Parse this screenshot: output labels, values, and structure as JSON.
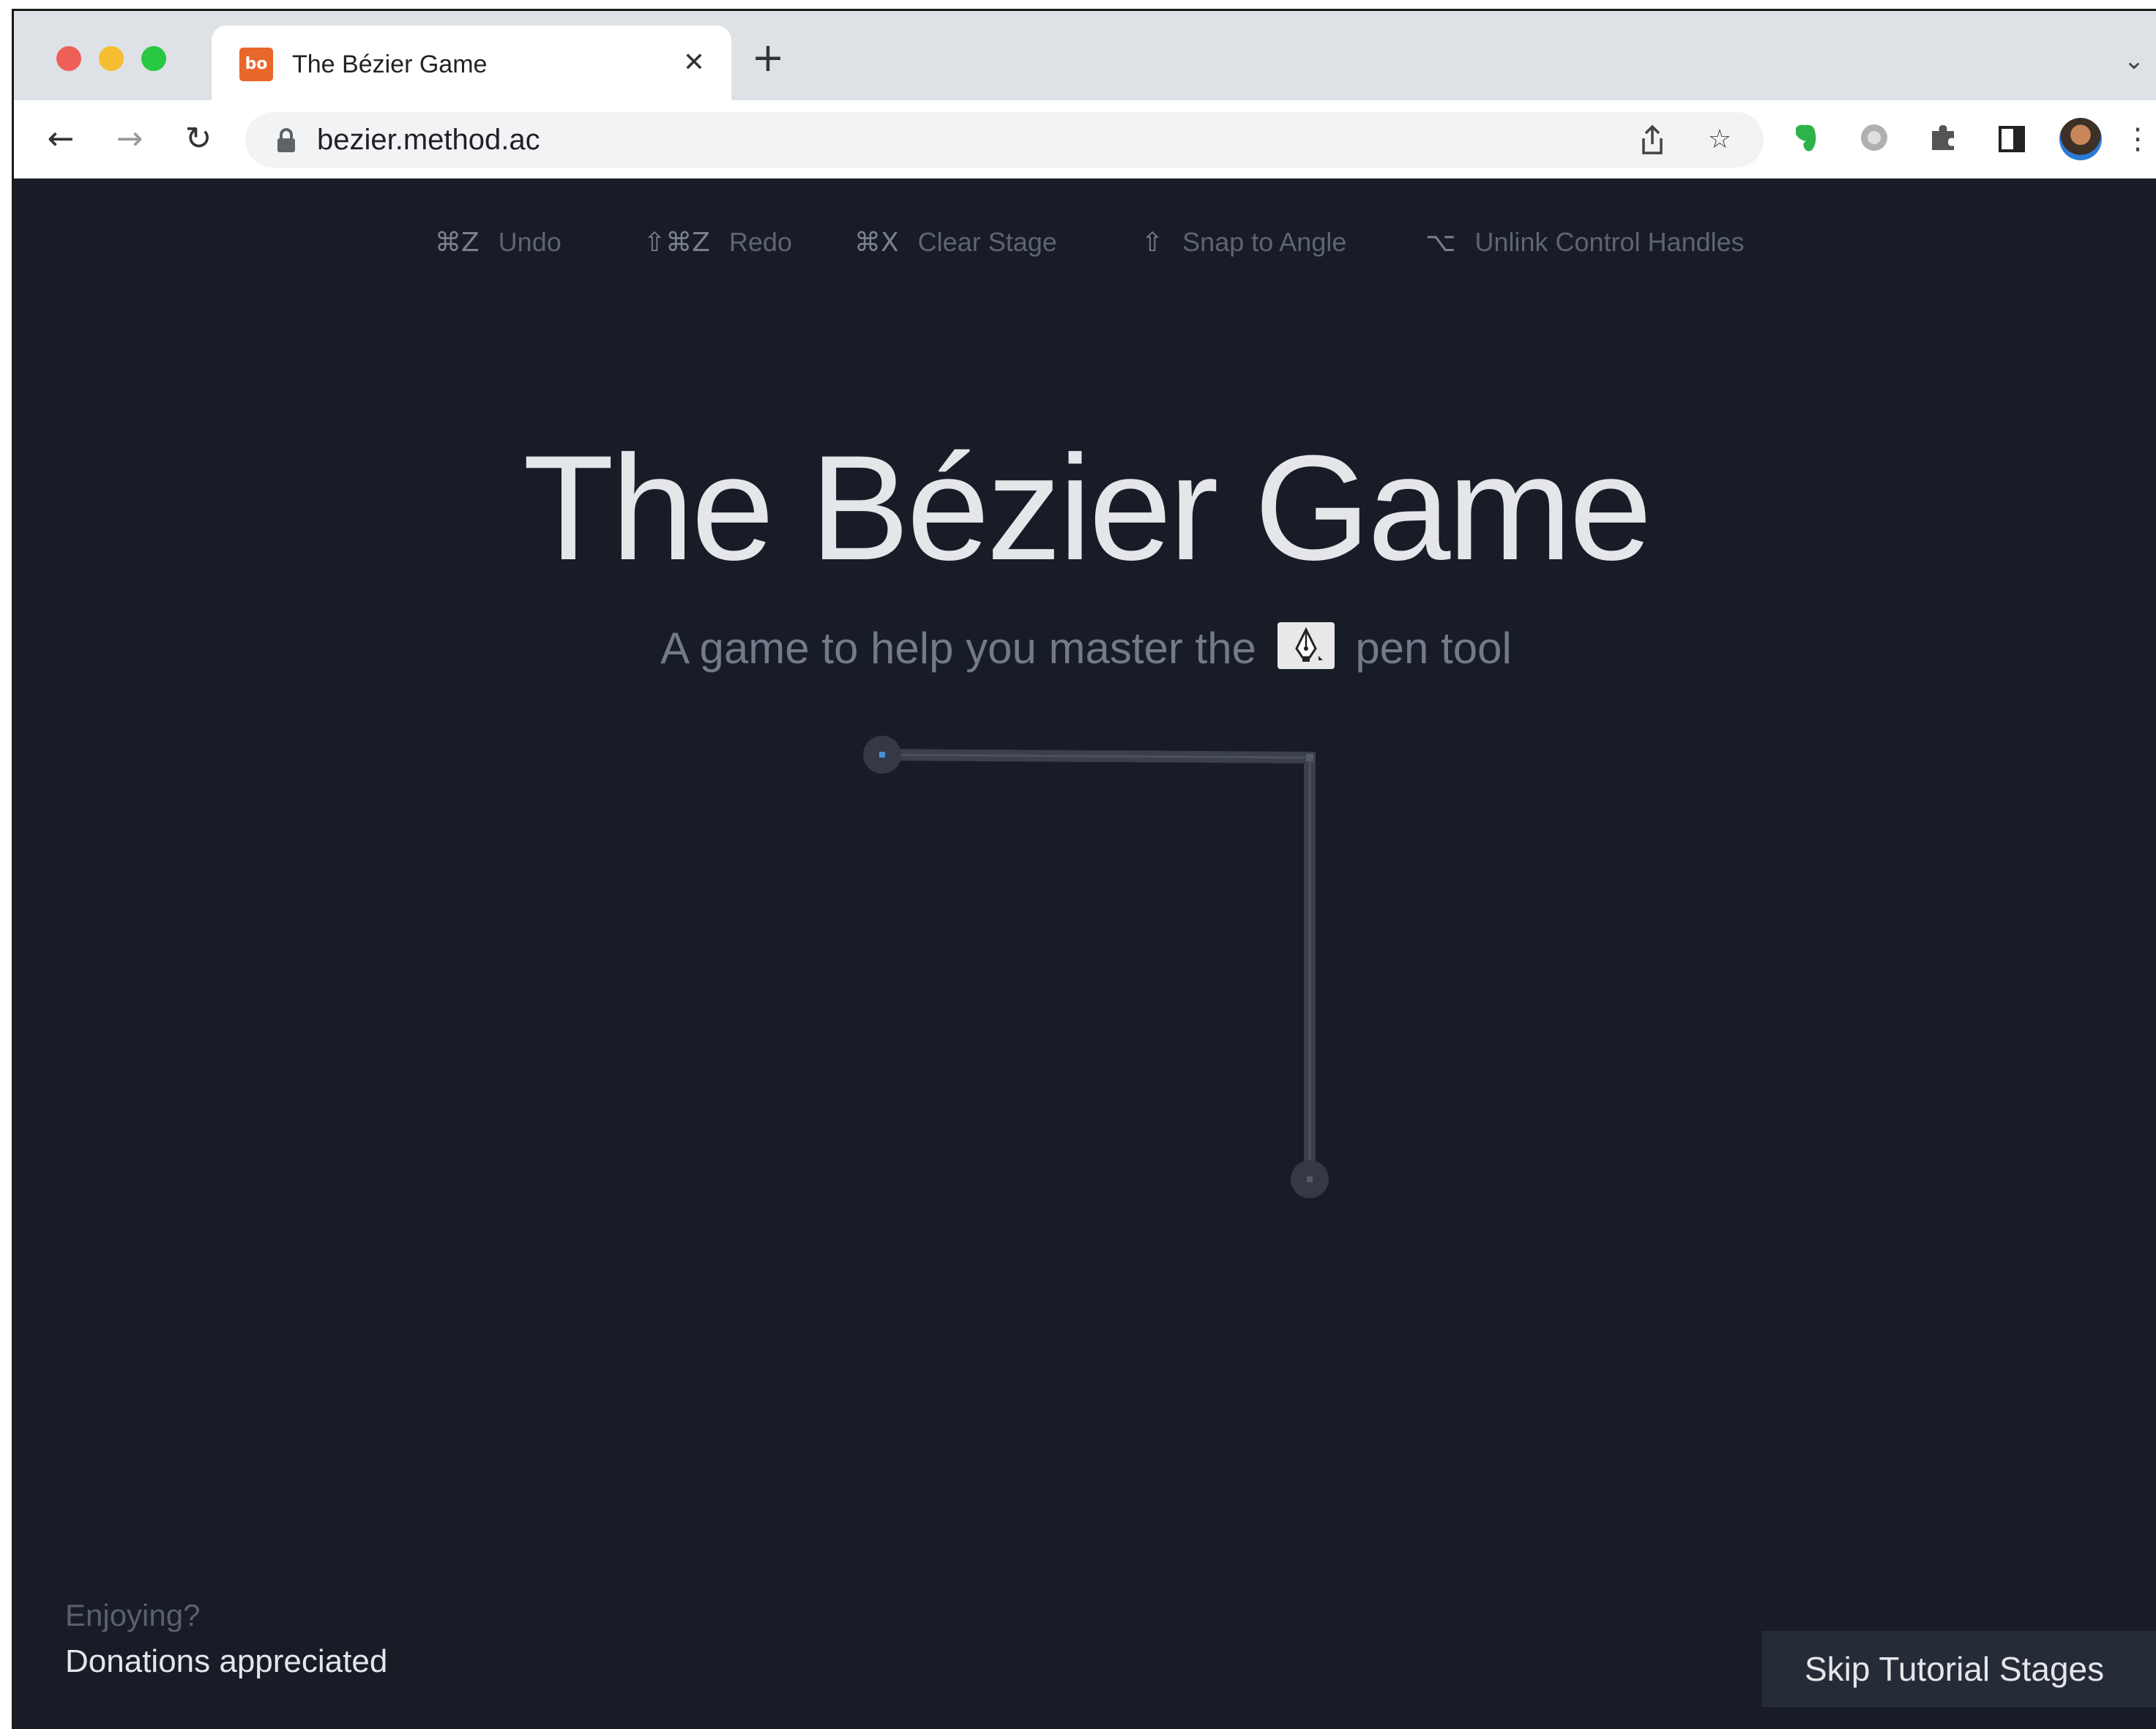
{
  "browser": {
    "tab": {
      "title": "The Bézier Game",
      "favicon": "bo",
      "close_glyph": "✕"
    },
    "new_tab_glyph": "+",
    "tab_menu_glyph": "⌄",
    "nav": {
      "back_glyph": "←",
      "forward_glyph": "→",
      "reload_glyph": "↻"
    },
    "address_bar": {
      "url": "bezier.method.ac"
    },
    "icons": {
      "share": "share-icon",
      "star": "star-icon",
      "extensions": [
        "evernote-icon",
        "gear-icon",
        "puzzle-icon",
        "side-panel-icon",
        "profile-avatar",
        "menu-icon"
      ]
    }
  },
  "page": {
    "shortcuts": [
      {
        "key": "⌘Z",
        "label": "Undo"
      },
      {
        "key": "⇧⌘Z",
        "label": "Redo"
      },
      {
        "key": "⌘X",
        "label": "Clear Stage"
      },
      {
        "key": "⇧",
        "label": "Snap to Angle"
      },
      {
        "key": "⌥",
        "label": "Unlink Control Handles"
      }
    ],
    "title": "The Bézier Game",
    "subtitle_before": "A game to help you master the",
    "subtitle_after": "pen tool",
    "donate_question": "Enjoying?",
    "donate_link": "Donations appreciated",
    "skip_button": "Skip Tutorial Stages"
  },
  "colors": {
    "page_background": "#181c27",
    "title": "#e4e6ea",
    "muted_text": "#737a8a",
    "path_stroke": "#3a3f4b",
    "skip_button_bg": "#262b38",
    "favicon_orange": "#e8672a"
  }
}
